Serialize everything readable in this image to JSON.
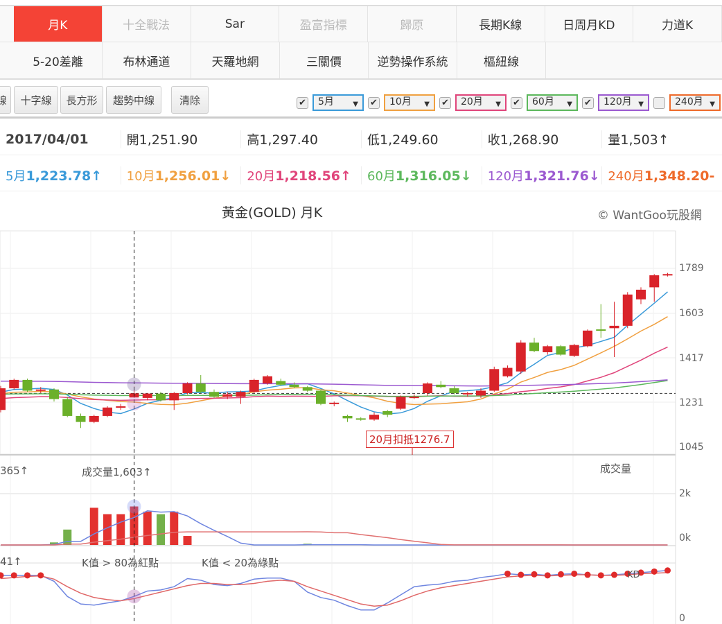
{
  "tabs_row1": [
    "月K",
    "十全戰法",
    "Sar",
    "盈富指標",
    "歸原",
    "長期K線",
    "日周月KD",
    "力道K"
  ],
  "tabs_row2": [
    "5-20差離",
    "布林通道",
    "天羅地網",
    "三關價",
    "逆勢操作系統",
    "樞紐線"
  ],
  "active_tab": "月K",
  "toolbar": {
    "tools": [
      "線",
      "十字線",
      "長方形",
      "趨勢中線"
    ],
    "clear": "清除"
  },
  "ma_selectors": [
    {
      "label": "5月",
      "checked": true,
      "color": "#3a9ad9"
    },
    {
      "label": "10月",
      "checked": true,
      "color": "#f0a040"
    },
    {
      "label": "20月",
      "checked": true,
      "color": "#e0457b"
    },
    {
      "label": "60月",
      "checked": true,
      "color": "#5cb85c"
    },
    {
      "label": "120月",
      "checked": true,
      "color": "#9b59d0"
    },
    {
      "label": "240月",
      "checked": false,
      "color": "#ee6a2a"
    }
  ],
  "ohlc": {
    "date": "2017/04/01",
    "open_label": "開",
    "open": "1,251.90",
    "high_label": "高",
    "high": "1,297.40",
    "low_label": "低",
    "low": "1,249.60",
    "close_label": "收",
    "close": "1,268.90",
    "vol_label": "量",
    "vol": "1,503↑"
  },
  "ma_values": [
    {
      "label": "5月",
      "value": "1,223.78↑",
      "color": "#3a9ad9"
    },
    {
      "label": "10月",
      "value": "1,256.01↓",
      "color": "#f0a040"
    },
    {
      "label": "20月",
      "value": "1,218.56↑",
      "color": "#e0457b"
    },
    {
      "label": "60月",
      "value": "1,316.05↓",
      "color": "#5cb85c"
    },
    {
      "label": "120月",
      "value": "1,321.76↓",
      "color": "#9b59d0"
    },
    {
      "label": "240月",
      "value": "1,348.20-",
      "color": "#ee6a2a"
    }
  ],
  "chart": {
    "title": "黃金(GOLD) 月K",
    "copyright": "© WantGoo玩股網",
    "price_ticks": [
      "1789",
      "1603",
      "1417",
      "1231",
      "1045"
    ],
    "callout": "20月扣抵1276.7",
    "vol_prev": "365↑",
    "vol_label": "成交量1,603↑",
    "vol_title": "成交量",
    "vol_ticks": [
      "2k",
      "0k"
    ],
    "kd_prev": "41↑",
    "kd_red_note": "K值 > 80為紅點",
    "kd_green_note": "K值 < 20為綠點",
    "kd_tag": "KD",
    "kd_ticks": [
      "0"
    ]
  },
  "chart_data": {
    "type": "candlestick",
    "price_range": [
      1045,
      1789
    ],
    "ohlc": [
      [
        1200,
        1300,
        1190,
        1290
      ],
      [
        1290,
        1330,
        1285,
        1325
      ],
      [
        1325,
        1330,
        1275,
        1280
      ],
      [
        1280,
        1295,
        1270,
        1285
      ],
      [
        1285,
        1290,
        1235,
        1245
      ],
      [
        1245,
        1255,
        1170,
        1175
      ],
      [
        1175,
        1185,
        1125,
        1150
      ],
      [
        1150,
        1180,
        1145,
        1175
      ],
      [
        1175,
        1215,
        1170,
        1210
      ],
      [
        1210,
        1225,
        1200,
        1215
      ],
      [
        1251.9,
        1297.4,
        1249.6,
        1268.9
      ],
      [
        1250,
        1270,
        1240,
        1268
      ],
      [
        1268,
        1275,
        1235,
        1240
      ],
      [
        1240,
        1275,
        1200,
        1270
      ],
      [
        1270,
        1315,
        1265,
        1310
      ],
      [
        1310,
        1345,
        1270,
        1275
      ],
      [
        1275,
        1285,
        1250,
        1255
      ],
      [
        1255,
        1275,
        1245,
        1265
      ],
      [
        1255,
        1280,
        1225,
        1275
      ],
      [
        1275,
        1330,
        1270,
        1325
      ],
      [
        1310,
        1345,
        1305,
        1340
      ],
      [
        1320,
        1330,
        1300,
        1305
      ],
      [
        1305,
        1315,
        1290,
        1295
      ],
      [
        1295,
        1300,
        1275,
        1280
      ],
      [
        1280,
        1285,
        1220,
        1225
      ],
      [
        1225,
        1235,
        1215,
        1230
      ],
      [
        1175,
        1180,
        1150,
        1165
      ],
      [
        1165,
        1170,
        1155,
        1160
      ],
      [
        1160,
        1190,
        1155,
        1180
      ],
      [
        1195,
        1200,
        1170,
        1180
      ],
      [
        1205,
        1260,
        1200,
        1255
      ],
      [
        1255,
        1265,
        1245,
        1255
      ],
      [
        1270,
        1315,
        1260,
        1310
      ],
      [
        1305,
        1320,
        1290,
        1295
      ],
      [
        1290,
        1300,
        1265,
        1270
      ],
      [
        1265,
        1275,
        1255,
        1270
      ],
      [
        1260,
        1290,
        1250,
        1280
      ],
      [
        1280,
        1380,
        1275,
        1370
      ],
      [
        1340,
        1385,
        1335,
        1375
      ],
      [
        1360,
        1490,
        1350,
        1480
      ],
      [
        1480,
        1500,
        1440,
        1445
      ],
      [
        1440,
        1470,
        1430,
        1465
      ],
      [
        1465,
        1470,
        1425,
        1430
      ],
      [
        1425,
        1475,
        1420,
        1470
      ],
      [
        1465,
        1535,
        1460,
        1530
      ],
      [
        1535,
        1640,
        1500,
        1530
      ],
      [
        1540,
        1650,
        1420,
        1550
      ],
      [
        1550,
        1690,
        1540,
        1680
      ],
      [
        1660,
        1710,
        1640,
        1700
      ],
      [
        1710,
        1765,
        1650,
        1760
      ],
      [
        1765,
        1770,
        1755,
        1765
      ]
    ],
    "volume_k": [
      0,
      0,
      0,
      0,
      0.1,
      0.6,
      0,
      1.45,
      1.2,
      1.2,
      1.5,
      1.3,
      1.2,
      1.3,
      0.35,
      0,
      0,
      0,
      0,
      0,
      0,
      0,
      0,
      0.05,
      0,
      0,
      0,
      0,
      0,
      0,
      0,
      0,
      0,
      0,
      0,
      0,
      0,
      0,
      0,
      0,
      0,
      0,
      0,
      0,
      0,
      0,
      0,
      0,
      0,
      0,
      0
    ],
    "volume_range": [
      0,
      2
    ],
    "K": [
      81,
      81,
      81,
      81,
      70,
      42,
      28,
      26,
      30,
      34,
      42,
      52,
      54,
      60,
      75,
      72,
      64,
      62,
      66,
      74,
      76,
      76,
      70,
      50,
      40,
      35,
      25,
      17,
      17,
      30,
      45,
      60,
      63,
      65,
      70,
      72,
      77,
      80,
      84,
      82,
      83,
      81,
      83,
      84,
      82,
      81,
      82,
      84,
      86,
      88,
      90
    ],
    "D": [
      75,
      77,
      79,
      80,
      74,
      60,
      48,
      40,
      36,
      34,
      38,
      44,
      50,
      56,
      62,
      66,
      66,
      64,
      64,
      66,
      70,
      72,
      70,
      60,
      52,
      44,
      36,
      28,
      24,
      26,
      34,
      44,
      52,
      58,
      62,
      66,
      70,
      74,
      78,
      80,
      81,
      80,
      81,
      82,
      82,
      81,
      81,
      82,
      84,
      85,
      86
    ],
    "crosshair_index": 10
  }
}
